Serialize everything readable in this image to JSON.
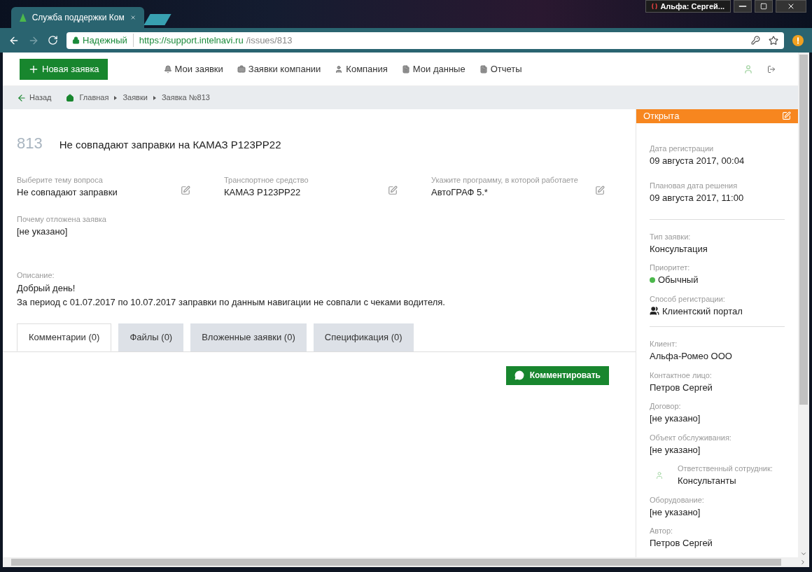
{
  "browser": {
    "tab_title": "Служба поддержки Ком",
    "profile": "Альфа: Сергей...",
    "secure_label": "Надежный",
    "url_host": "https://support.intelnavi.ru",
    "url_path": "/issues/813"
  },
  "navbar": {
    "new_button": "Новая заявка",
    "links": [
      {
        "kind": "bell",
        "label": "Мои заявки"
      },
      {
        "kind": "briefcase",
        "label": "Заявки компании"
      },
      {
        "kind": "user",
        "label": "Компания"
      },
      {
        "kind": "file",
        "label": "Мои данные"
      },
      {
        "kind": "file",
        "label": "Отчеты"
      }
    ]
  },
  "breadcrumbs": {
    "back": "Назад",
    "items": [
      "Главная",
      "Заявки",
      "Заявка №813"
    ]
  },
  "issue": {
    "number": "813",
    "title": "Не совпадают заправки на КАМАЗ Р123РР22",
    "fields": [
      {
        "label": "Выберите тему вопроса",
        "value": "Не совпадают заправки",
        "editable": true
      },
      {
        "label": "Транспортное средство",
        "value": "КАМАЗ Р123РР22",
        "editable": true
      },
      {
        "label": "Укажите программу, в которой работаете",
        "value": "АвтоГРАФ 5.*",
        "editable": true
      },
      {
        "label": "Почему отложена заявка",
        "value": "[не указано]",
        "editable": false
      }
    ],
    "description_label": "Описание:",
    "description": [
      "Добрый день!",
      "За период с 01.07.2017 по 10.07.2017 заправки по данным навигации не совпали с чеками водителя."
    ]
  },
  "tabs": [
    {
      "label": "Комментарии (0)",
      "selected": true
    },
    {
      "label": "Файлы (0)",
      "selected": false
    },
    {
      "label": "Вложенные заявки (0)",
      "selected": false
    },
    {
      "label": "Спецификация (0)",
      "selected": false
    }
  ],
  "comment_button": "Комментировать",
  "sidebar": {
    "status": "Открыта",
    "groups": [
      [
        {
          "kind": "plain",
          "label": "Дата регистрации",
          "value": "09 августа 2017, 00:04"
        },
        {
          "kind": "plain",
          "label": "Плановая дата решения",
          "value": "09 августа 2017, 11:00"
        }
      ],
      [
        {
          "kind": "plain",
          "label": "Тип заявки:",
          "value": "Консультация"
        },
        {
          "kind": "dot",
          "label": "Приоритет:",
          "value": "Обычный",
          "color": "#4cb84c"
        },
        {
          "kind": "users",
          "label": "Способ регистрации:",
          "value": "Клиентский портал"
        }
      ],
      [
        {
          "kind": "plain",
          "label": "Клиент:",
          "value": "Альфа-Ромео ООО"
        },
        {
          "kind": "plain",
          "label": "Контактное лицо:",
          "value": "Петров Сергей"
        },
        {
          "kind": "plain",
          "label": "Договор:",
          "value": "[не указано]"
        },
        {
          "kind": "plain",
          "label": "Объект обслуживания:",
          "value": "[не указано]"
        },
        {
          "kind": "person",
          "label": "Ответственный сотрудник:",
          "value": "Консультанты"
        },
        {
          "kind": "plain",
          "label": "Оборудование:",
          "value": "[не указано]"
        },
        {
          "kind": "plain",
          "label": "Автор:",
          "value": "Петров Сергей"
        }
      ]
    ]
  }
}
